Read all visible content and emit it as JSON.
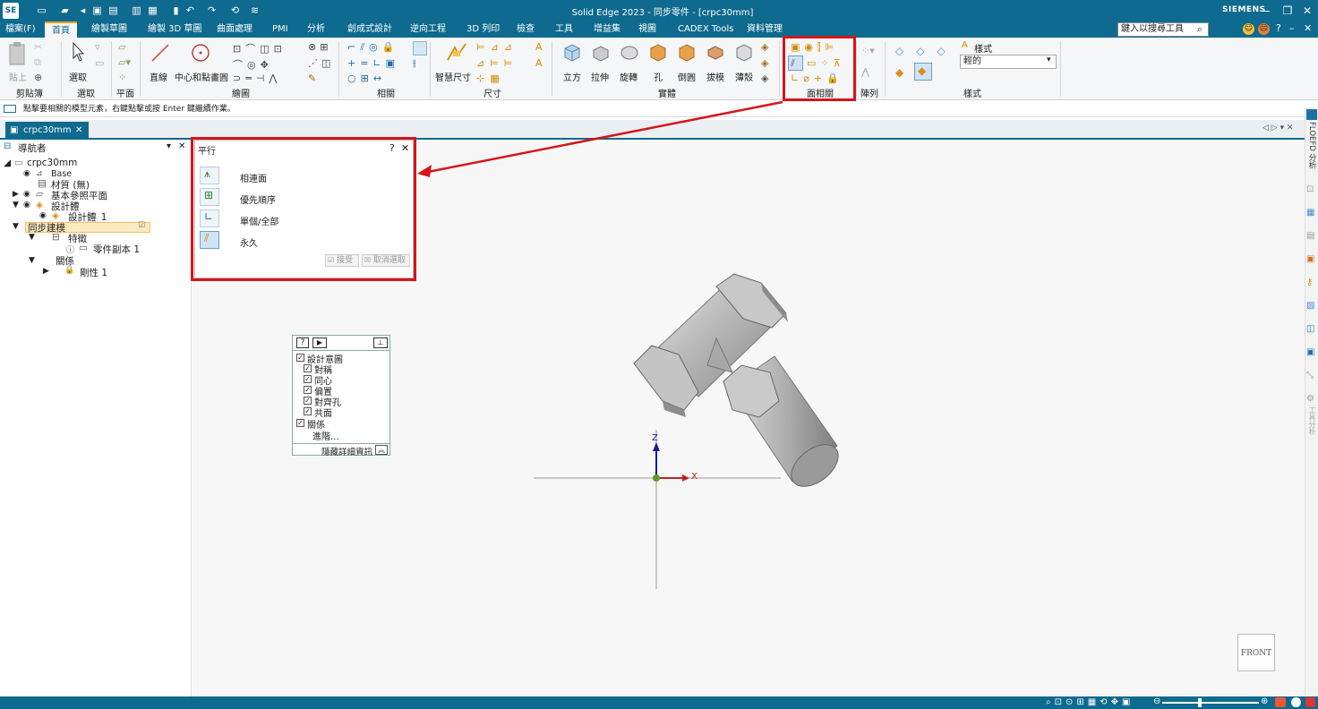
{
  "app": {
    "title": "Solid Edge 2023 - 同步零件 - [crpc30mm]",
    "brand": "SIEMENS",
    "logo": "SE"
  },
  "menu": {
    "tabs": [
      "檔案(F)",
      "首頁",
      "繪製草圖",
      "繪製 3D 草圖",
      "曲面處理",
      "PMI",
      "分析",
      "創成式設計",
      "逆向工程",
      "3D 列印",
      "檢查",
      "工具",
      "增益集",
      "視圖",
      "CADEX Tools",
      "資料管理"
    ],
    "active": "首頁",
    "search_placeholder": "鍵入以搜尋工具"
  },
  "ribbon": {
    "groups": [
      "剪貼簿",
      "選取",
      "平面",
      "繪圖",
      "相關",
      "尺寸",
      "實體",
      "面相關",
      "陣列",
      "樣式"
    ],
    "buttons": {
      "paste": "貼上",
      "select": "選取",
      "line": "直線",
      "center_circle": "中心和點畫圓",
      "smart_dim": "智慧尺寸",
      "box": "立方",
      "extrude": "拉伸",
      "revolve": "旋轉",
      "hole": "孔",
      "round": "倒圓",
      "draft": "拔模",
      "thin": "薄殼"
    },
    "style_label": "樣式",
    "style_value": "輕的"
  },
  "prompt": {
    "text": "點擊要相關的模型元素，右鍵點擊或按 Enter 鍵繼續作業。"
  },
  "document_tab": {
    "label": "crpc30mm"
  },
  "navigator": {
    "title": "導航者",
    "root": "crpc30mm",
    "items": {
      "base": "Base",
      "material": "材質 (無)",
      "ref_planes": "基本參照平面",
      "design_body": "設計體",
      "design_body_1": "設計體_1",
      "sync_modeling": "同步建模",
      "features": "特徵",
      "part_copy": "零件副本 1",
      "relations": "關係",
      "rigid": "剛性 1"
    }
  },
  "parallel_panel": {
    "title": "平行",
    "options": [
      "相連面",
      "優先順序",
      "單個/全部",
      "永久"
    ],
    "accept": "接受",
    "cancel": "取消選取"
  },
  "relations_panel": {
    "items": [
      "設計意圖",
      "對稱",
      "同心",
      "偏置",
      "對齊孔",
      "共面",
      "關係",
      "進階..."
    ],
    "footer": "隱藏詳細資訊"
  },
  "right_sidebar": {
    "label1": "FLOEFD 分析",
    "label2": "工具分析"
  },
  "view": {
    "cube_label": "FRONT",
    "axis_z": "Z",
    "axis_x": "X"
  },
  "colors": {
    "titlebar": "#0e6a8e",
    "highlight": "#d7141a",
    "accent": "#e8a317"
  }
}
